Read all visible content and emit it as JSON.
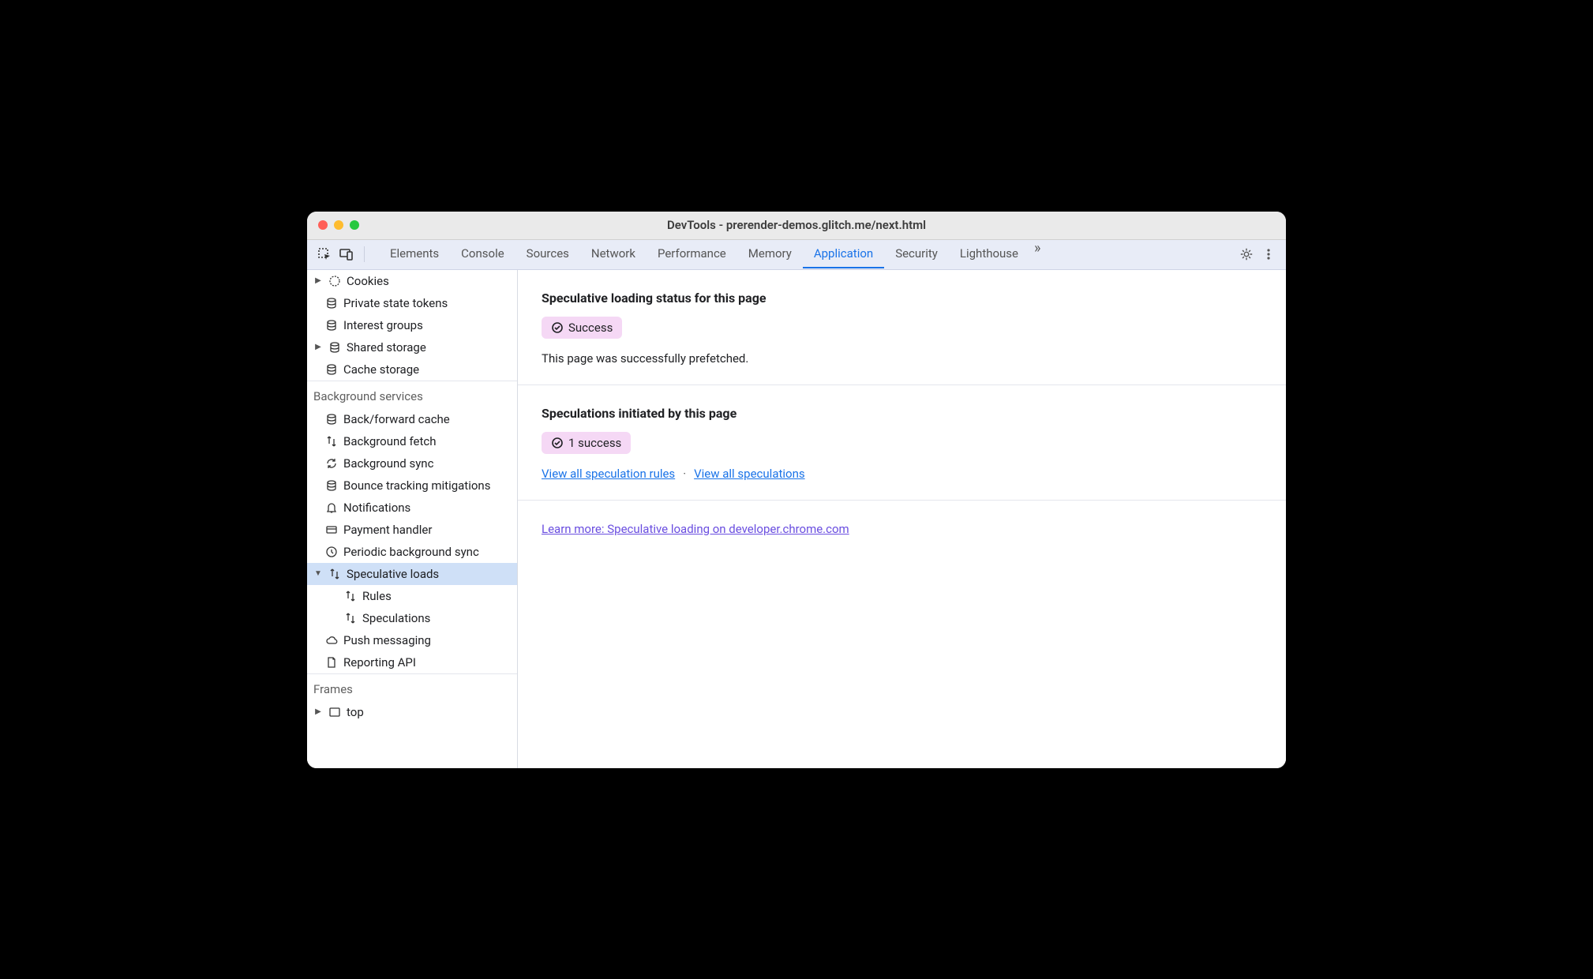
{
  "window": {
    "title": "DevTools - prerender-demos.glitch.me/next.html"
  },
  "tabs": {
    "items": [
      "Elements",
      "Console",
      "Sources",
      "Network",
      "Performance",
      "Memory",
      "Application",
      "Security",
      "Lighthouse"
    ],
    "active": "Application"
  },
  "sidebar": {
    "storage_items": [
      {
        "label": "Cookies",
        "icon": "cookie",
        "expandable": true
      },
      {
        "label": "Private state tokens",
        "icon": "db"
      },
      {
        "label": "Interest groups",
        "icon": "db"
      },
      {
        "label": "Shared storage",
        "icon": "db",
        "expandable": true
      },
      {
        "label": "Cache storage",
        "icon": "db"
      }
    ],
    "bg_header": "Background services",
    "bg_items": [
      {
        "label": "Back/forward cache",
        "icon": "db"
      },
      {
        "label": "Background fetch",
        "icon": "transfer"
      },
      {
        "label": "Background sync",
        "icon": "sync"
      },
      {
        "label": "Bounce tracking mitigations",
        "icon": "db"
      },
      {
        "label": "Notifications",
        "icon": "bell"
      },
      {
        "label": "Payment handler",
        "icon": "card"
      },
      {
        "label": "Periodic background sync",
        "icon": "clock"
      },
      {
        "label": "Speculative loads",
        "icon": "transfer",
        "selected": true,
        "expandable": true,
        "expanded": true
      },
      {
        "label": "Rules",
        "icon": "transfer",
        "indent": 2
      },
      {
        "label": "Speculations",
        "icon": "transfer",
        "indent": 2
      },
      {
        "label": "Push messaging",
        "icon": "cloud"
      },
      {
        "label": "Reporting API",
        "icon": "doc"
      }
    ],
    "frames_header": "Frames",
    "frames_items": [
      {
        "label": "top",
        "icon": "frame",
        "expandable": true
      }
    ]
  },
  "main": {
    "status_heading": "Speculative loading status for this page",
    "status_badge": "Success",
    "status_text": "This page was successfully prefetched.",
    "initiated_heading": "Speculations initiated by this page",
    "initiated_badge": "1 success",
    "link_rules": "View all speculation rules",
    "link_speculations": "View all speculations",
    "learn_more": "Learn more: Speculative loading on developer.chrome.com"
  }
}
